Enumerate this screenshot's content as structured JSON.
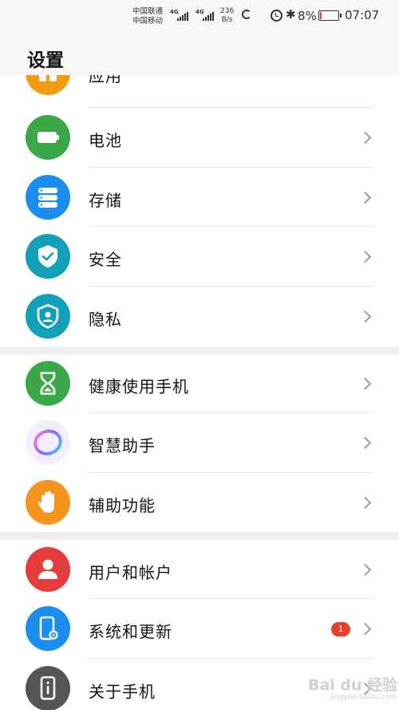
{
  "status_bar": {
    "carrier_1": "中国联通",
    "carrier_2": "中国移动",
    "sim1_tag": "4G",
    "sim2_tag": "4G",
    "speed_value": "236",
    "speed_unit": "B/s",
    "battery_pct": "8%",
    "battery_level": 0.08,
    "battery_color": "#e5393f",
    "time": "07:07"
  },
  "page": {
    "title": "设置"
  },
  "menu": [
    {
      "id": "apps",
      "label": "应用",
      "color": "#f39c12",
      "icon": "apps-icon"
    },
    {
      "id": "battery",
      "label": "电池",
      "color": "#3aa848",
      "icon": "battery-icon"
    },
    {
      "id": "storage",
      "label": "存储",
      "color": "#1a8ff0",
      "icon": "storage-icon"
    },
    {
      "id": "security",
      "label": "安全",
      "color": "#12a0b8",
      "icon": "shield-check-icon"
    },
    {
      "id": "privacy",
      "label": "隐私",
      "color": "#12a0b8",
      "icon": "privacy-shield-icon"
    },
    {
      "id": "digital-balance",
      "label": "健康使用手机",
      "color": "#3aa848",
      "icon": "hourglass-icon"
    },
    {
      "id": "assistant",
      "label": "智慧助手",
      "color": "#8e7cf0",
      "icon": "assistant-ring-icon"
    },
    {
      "id": "accessibility",
      "label": "辅助功能",
      "color": "#f7941d",
      "icon": "hand-icon"
    },
    {
      "id": "users",
      "label": "用户和帐户",
      "color": "#e63c3c",
      "icon": "user-icon"
    },
    {
      "id": "system",
      "label": "系统和更新",
      "color": "#1a8ff0",
      "icon": "phone-gear-icon",
      "badge": "1"
    },
    {
      "id": "about",
      "label": "关于手机",
      "color": "#555555",
      "icon": "info-phone-icon"
    }
  ],
  "watermark": {
    "text": "Bai du 经验",
    "sub": "jingyan.baidu.com"
  }
}
